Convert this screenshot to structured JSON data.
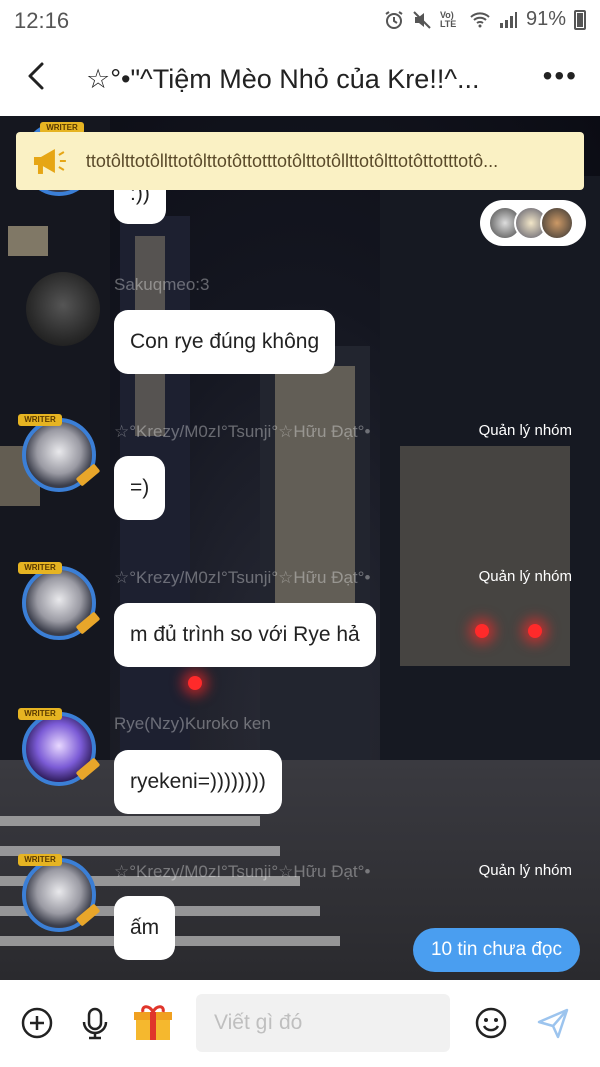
{
  "status_bar": {
    "time": "12:16",
    "network": "Vo) LTE",
    "battery": "91%"
  },
  "header": {
    "title": "☆°•\"^Tiệm Mèo Nhỏ của Kre!!^..."
  },
  "announcement": {
    "text": "ttotôlttotôllttotôlttotôttotttotôlttotôllttotôlttotôttotttotô..."
  },
  "messages": [
    {
      "text": ":))"
    },
    {
      "username": "Sakuqmeo:3",
      "text": "Con rye đúng không"
    },
    {
      "username": "☆°Krezy/M0zI°Tsunji°☆Hữu Đạt°•",
      "role": "Quản lý nhóm",
      "text": "=)"
    },
    {
      "username": "☆°Krezy/M0zI°Tsunji°☆Hữu Đạt°•",
      "role": "Quản lý nhóm",
      "text": "m đủ trình so với Rye hả"
    },
    {
      "username": "Rye(Nzy)Kuroko ken",
      "text": "ryekeni=))))))))"
    },
    {
      "username": "☆°Krezy/M0zI°Tsunji°☆Hữu Đạt°•",
      "role": "Quản lý nhóm",
      "text": "ấm"
    }
  ],
  "badge": {
    "text": "WRITER"
  },
  "unread_button": {
    "label": "10 tin chưa đọc"
  },
  "input_bar": {
    "placeholder": "Viết gì đó"
  },
  "colors": {
    "accent": "#4a9ef0",
    "announcement_bg": "#faf1c4",
    "avatar_ring": "#3b7fd6"
  }
}
